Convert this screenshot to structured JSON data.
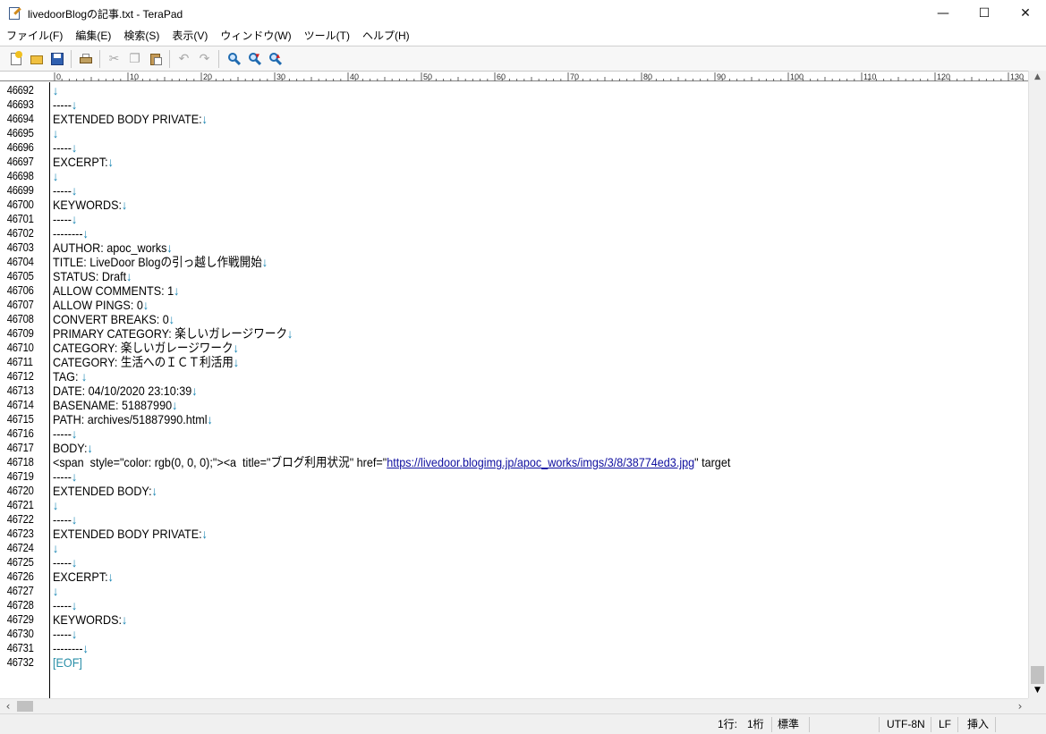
{
  "window": {
    "title": "livedoorBlogの記事.txt - TeraPad",
    "icon": "terapad-app-icon",
    "minimize": "—",
    "maximize": "☐",
    "close": "✕"
  },
  "menu": [
    "ファイル(F)",
    "編集(E)",
    "検索(S)",
    "表示(V)",
    "ウィンドウ(W)",
    "ツール(T)",
    "ヘルプ(H)"
  ],
  "toolbar": {
    "icons": [
      "new-file-icon",
      "open-folder-icon",
      "save-icon",
      "print-icon",
      "cut-icon",
      "copy-icon",
      "paste-icon",
      "undo-icon",
      "redo-icon",
      "find-icon",
      "find-next-icon",
      "find-prev-icon"
    ]
  },
  "ruler": {
    "labels": [
      "0",
      "10",
      "20",
      "30",
      "40",
      "50",
      "60",
      "70",
      "80",
      "90",
      "100",
      "110",
      "120",
      "130"
    ]
  },
  "editor": {
    "eol_mark": "↓",
    "lines": [
      {
        "num": "46692",
        "text": "",
        "eol": true
      },
      {
        "num": "46693",
        "text": "-----",
        "eol": true
      },
      {
        "num": "46694",
        "text": "EXTENDED BODY PRIVATE:",
        "eol": true
      },
      {
        "num": "46695",
        "text": "",
        "eol": true
      },
      {
        "num": "46696",
        "text": "-----",
        "eol": true
      },
      {
        "num": "46697",
        "text": "EXCERPT:",
        "eol": true
      },
      {
        "num": "46698",
        "text": "",
        "eol": true
      },
      {
        "num": "46699",
        "text": "-----",
        "eol": true
      },
      {
        "num": "46700",
        "text": "KEYWORDS:",
        "eol": true
      },
      {
        "num": "46701",
        "text": "-----",
        "eol": true
      },
      {
        "num": "46702",
        "text": "--------",
        "eol": true
      },
      {
        "num": "46703",
        "text": "AUTHOR: apoc_works",
        "eol": true
      },
      {
        "num": "46704",
        "text": "TITLE: LiveDoor Blogの引っ越し作戦開始",
        "eol": true
      },
      {
        "num": "46705",
        "text": "STATUS: Draft",
        "eol": true
      },
      {
        "num": "46706",
        "text": "ALLOW COMMENTS: 1",
        "eol": true
      },
      {
        "num": "46707",
        "text": "ALLOW PINGS: 0",
        "eol": true
      },
      {
        "num": "46708",
        "text": "CONVERT BREAKS: 0",
        "eol": true
      },
      {
        "num": "46709",
        "text": "PRIMARY CATEGORY: 楽しいガレージワーク",
        "eol": true
      },
      {
        "num": "46710",
        "text": "CATEGORY: 楽しいガレージワーク",
        "eol": true
      },
      {
        "num": "46711",
        "text": "CATEGORY: 生活へのＩＣＴ利活用",
        "eol": true
      },
      {
        "num": "46712",
        "text": "TAG: ",
        "eol": true
      },
      {
        "num": "46713",
        "text": "DATE: 04/10/2020 23:10:39",
        "eol": true
      },
      {
        "num": "46714",
        "text": "BASENAME: 51887990",
        "eol": true
      },
      {
        "num": "46715",
        "text": "PATH: archives/51887990.html",
        "eol": true
      },
      {
        "num": "46716",
        "text": "-----",
        "eol": true
      },
      {
        "num": "46717",
        "text": "BODY:",
        "eol": true
      },
      {
        "num": "46718",
        "text": "",
        "eol": false,
        "link_line": true
      },
      {
        "num": "46719",
        "text": "-----",
        "eol": true
      },
      {
        "num": "46720",
        "text": "EXTENDED BODY:",
        "eol": true
      },
      {
        "num": "46721",
        "text": "",
        "eol": true
      },
      {
        "num": "46722",
        "text": "-----",
        "eol": true
      },
      {
        "num": "46723",
        "text": "EXTENDED BODY PRIVATE:",
        "eol": true
      },
      {
        "num": "46724",
        "text": "",
        "eol": true
      },
      {
        "num": "46725",
        "text": "-----",
        "eol": true
      },
      {
        "num": "46726",
        "text": "EXCERPT:",
        "eol": true
      },
      {
        "num": "46727",
        "text": "",
        "eol": true
      },
      {
        "num": "46728",
        "text": "-----",
        "eol": true
      },
      {
        "num": "46729",
        "text": "KEYWORDS:",
        "eol": true
      },
      {
        "num": "46730",
        "text": "-----",
        "eol": true
      },
      {
        "num": "46731",
        "text": "--------",
        "eol": true
      },
      {
        "num": "46732",
        "text": "",
        "eol": false,
        "eof": true
      }
    ],
    "link_line": {
      "before": "<span  style=\"color: rgb(0, 0, 0);\"><a  title=\"ブログ利用状況\" href=\"",
      "url": "https://livedoor.blogimg.jp/apoc_works/imgs/3/8/38774ed3.jpg",
      "after": "\" target"
    },
    "eof_mark": "[EOF]",
    "colors": {
      "eol": "#1080b0",
      "eof": "#2a8fa8",
      "link": "#1010a0"
    }
  },
  "statusbar": {
    "line": "1行:",
    "col": "1桁",
    "mode": "標準",
    "encoding": "UTF-8N",
    "newline": "LF",
    "insert": "挿入"
  }
}
